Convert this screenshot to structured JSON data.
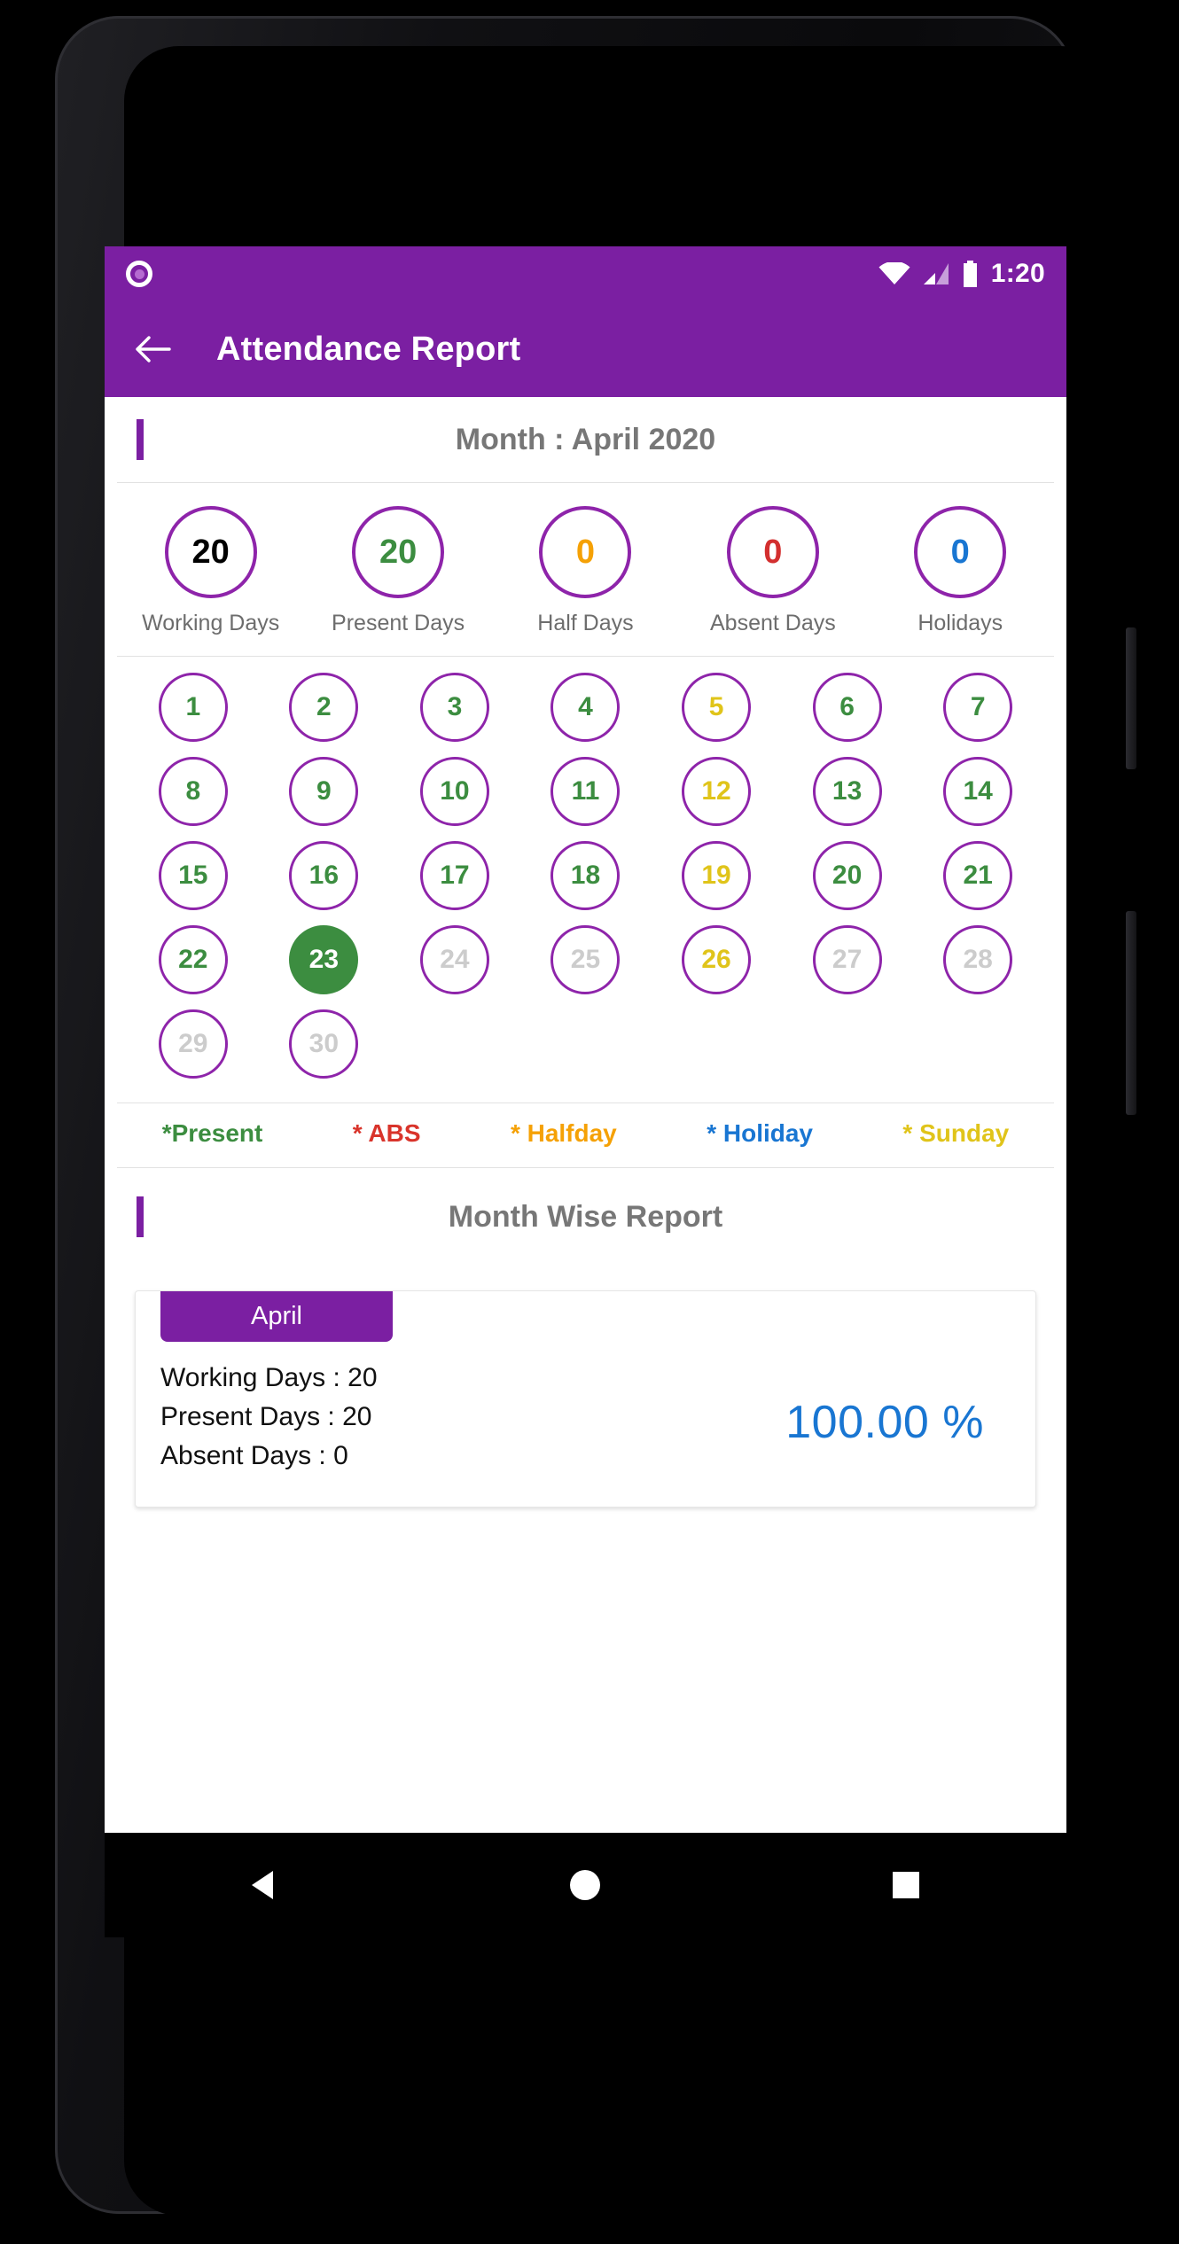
{
  "statusbar": {
    "time": "1:20",
    "icons": [
      "record-ring-icon",
      "wifi-icon",
      "signal-icon",
      "battery-icon"
    ]
  },
  "appbar": {
    "back_label": "back-arrow",
    "title": "Attendance Report"
  },
  "month_section": {
    "title": "Month : April 2020"
  },
  "stats": [
    {
      "value": "20",
      "label": "Working Days",
      "color": "#000000"
    },
    {
      "value": "20",
      "label": "Present Days",
      "color": "#3C8D40"
    },
    {
      "value": "0",
      "label": "Half Days",
      "color": "#F5A105"
    },
    {
      "value": "0",
      "label": "Absent Days",
      "color": "#D32F2F"
    },
    {
      "value": "0",
      "label": "Holidays",
      "color": "#1976D2"
    }
  ],
  "calendar": {
    "rows": [
      [
        {
          "day": "1",
          "state": "present"
        },
        {
          "day": "2",
          "state": "present"
        },
        {
          "day": "3",
          "state": "present"
        },
        {
          "day": "4",
          "state": "present"
        },
        {
          "day": "5",
          "state": "sunday"
        },
        {
          "day": "6",
          "state": "present"
        },
        {
          "day": "7",
          "state": "present"
        }
      ],
      [
        {
          "day": "8",
          "state": "present"
        },
        {
          "day": "9",
          "state": "present"
        },
        {
          "day": "10",
          "state": "present"
        },
        {
          "day": "11",
          "state": "present"
        },
        {
          "day": "12",
          "state": "sunday"
        },
        {
          "day": "13",
          "state": "present"
        },
        {
          "day": "14",
          "state": "present"
        }
      ],
      [
        {
          "day": "15",
          "state": "present"
        },
        {
          "day": "16",
          "state": "present"
        },
        {
          "day": "17",
          "state": "present"
        },
        {
          "day": "18",
          "state": "present"
        },
        {
          "day": "19",
          "state": "sunday"
        },
        {
          "day": "20",
          "state": "present"
        },
        {
          "day": "21",
          "state": "present"
        }
      ],
      [
        {
          "day": "22",
          "state": "present"
        },
        {
          "day": "23",
          "state": "today"
        },
        {
          "day": "24",
          "state": "future"
        },
        {
          "day": "25",
          "state": "future"
        },
        {
          "day": "26",
          "state": "sunday"
        },
        {
          "day": "27",
          "state": "future"
        },
        {
          "day": "28",
          "state": "future"
        }
      ],
      [
        {
          "day": "29",
          "state": "future"
        },
        {
          "day": "30",
          "state": "future"
        }
      ]
    ],
    "state_colors": {
      "present": "#3C8D40",
      "sunday": "#E0C41A",
      "future": "#CCCCCC",
      "today": "#FFFFFF"
    }
  },
  "legend": [
    {
      "label": "*Present",
      "color": "#3C8D40"
    },
    {
      "label": "* ABS",
      "color": "#D9342B"
    },
    {
      "label": "* Halfday",
      "color": "#F5A105"
    },
    {
      "label": "* Holiday",
      "color": "#1976D2"
    },
    {
      "label": "* Sunday",
      "color": "#E0C41A"
    }
  ],
  "monthwise": {
    "title": "Month Wise Report",
    "chip": "April",
    "lines": [
      "Working Days : 20",
      "Present Days : 20",
      "Absent Days : 0"
    ],
    "percentage": "100.00 %"
  },
  "navbar": {
    "back": "nav-back-triangle-icon",
    "home": "nav-home-circle-icon",
    "recents": "nav-recents-square-icon"
  },
  "theme": {
    "primary": "#7B1FA2",
    "circle_stroke": "#8E24AA",
    "accent_blue": "#1976D2"
  }
}
